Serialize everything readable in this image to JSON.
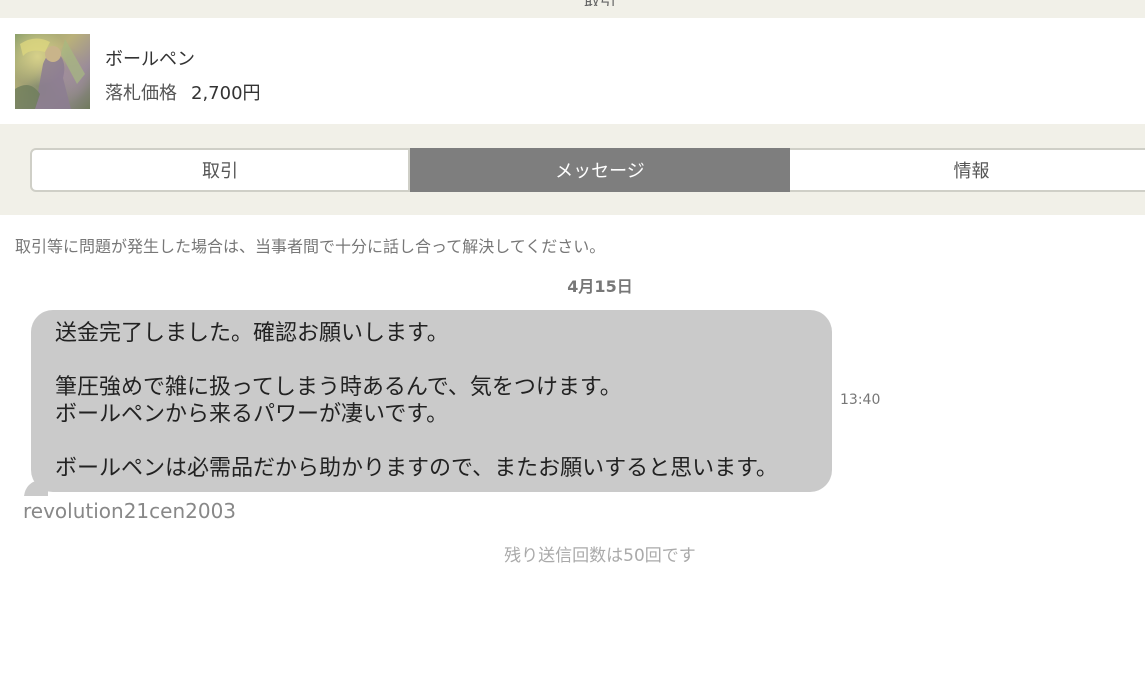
{
  "header": {
    "partial_title": "取引"
  },
  "item": {
    "name": "ボールペン",
    "price_label": "落札価格",
    "price_value": "2,700円"
  },
  "tabs": [
    {
      "label": "取引",
      "active": false
    },
    {
      "label": "メッセージ",
      "active": true
    },
    {
      "label": "情報",
      "active": false
    }
  ],
  "notice": "取引等に問題が発生した場合は、当事者間で十分に話し合って解決してください。",
  "date_separator": "4月15日",
  "message": {
    "lines": [
      "送金完了しました。確認お願いします。",
      "",
      "筆圧強めで雑に扱ってしまう時あるんで、気をつけます。",
      "ボールペンから来るパワーが凄いです。",
      "",
      "ボールペンは必需品だから助かりますので、またお願いすると思います。"
    ],
    "time": "13:40",
    "sender": "revolution21cen2003"
  },
  "remaining_count": "残り送信回数は50回です",
  "colors": {
    "band_bg": "#f1f0e8",
    "tab_active_bg": "#7e7e7e",
    "bubble_bg": "#cacaca"
  }
}
